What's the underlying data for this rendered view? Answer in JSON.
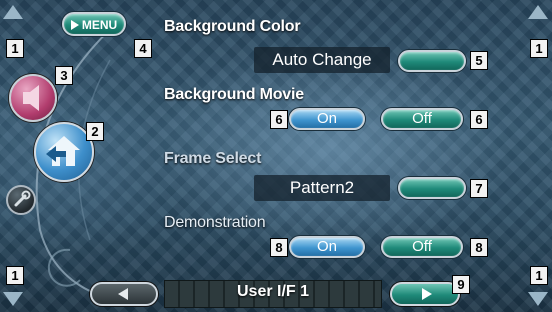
{
  "header": {
    "menu_label": "MENU"
  },
  "settings": {
    "background_color": {
      "label": "Background Color",
      "value": "Auto Change"
    },
    "background_movie": {
      "label": "Background Movie",
      "on": "On",
      "off": "Off"
    },
    "frame_select": {
      "label": "Frame Select",
      "value": "Pattern2"
    },
    "demonstration": {
      "label": "Demonstration",
      "on": "On",
      "off": "Off"
    }
  },
  "footer": {
    "title": "User I/F 1"
  },
  "callouts": {
    "n1": "1",
    "n2": "2",
    "n3": "3",
    "n4": "4",
    "n5": "5",
    "n6": "6",
    "n7": "7",
    "n8": "8",
    "n9": "9"
  },
  "icons": {
    "left_panel": [
      "speaker-icon",
      "home-icon",
      "wrench-icon"
    ],
    "corners": [
      "scroll-up-icon",
      "scroll-down-icon"
    ]
  },
  "colors": {
    "accent_teal": "#1f8a79",
    "accent_blue": "#3f95cf",
    "callout_bg": "#f2f2f2"
  }
}
